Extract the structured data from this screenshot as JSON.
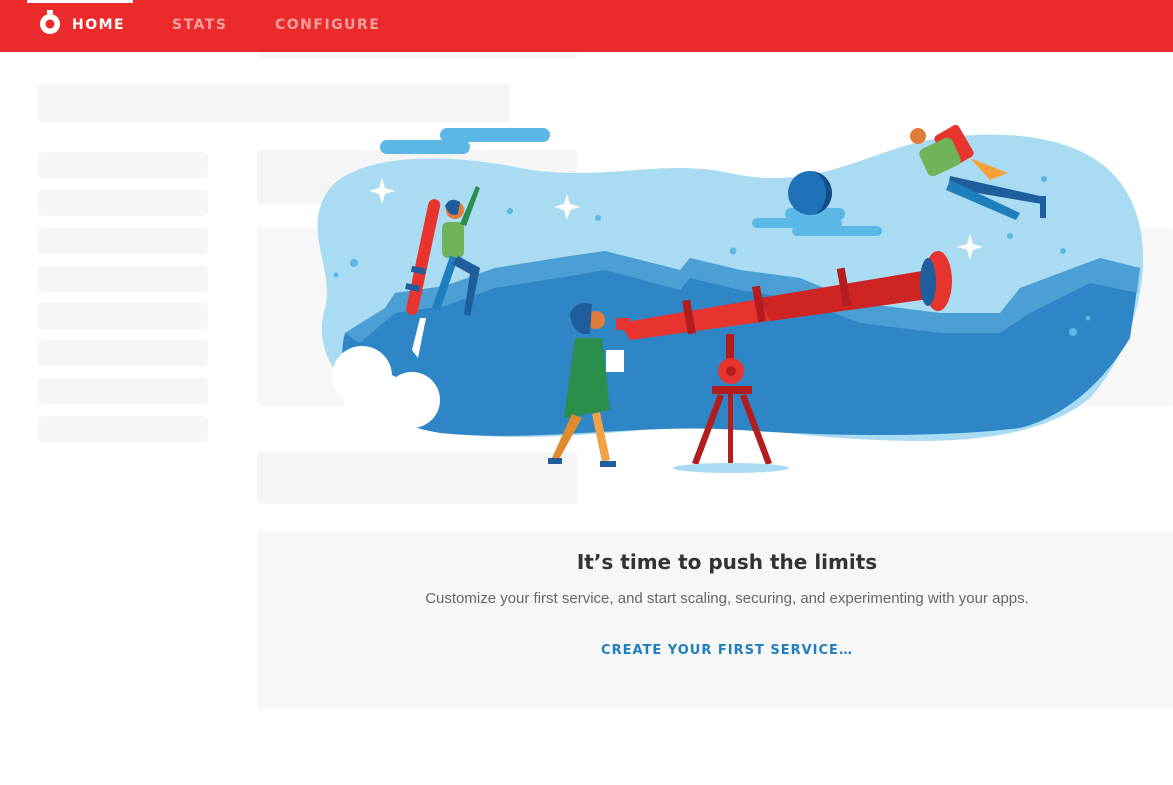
{
  "nav": {
    "items": [
      {
        "label": "HOME",
        "active": true
      },
      {
        "label": "STATS",
        "active": false
      },
      {
        "label": "CONFIGURE",
        "active": false
      }
    ],
    "logo_icon": "stopwatch-icon"
  },
  "empty_state": {
    "title": "It’s time to push the limits",
    "subtitle": "Customize your first service, and start scaling, securing, and experimenting with your apps.",
    "cta": "CREATE YOUR FIRST SERVICE…"
  },
  "colors": {
    "brand_red": "#ea2a2b",
    "link_blue": "#1f7fbd",
    "sky_blue": "#a9dcf3",
    "deep_blue": "#2f86c6",
    "skeleton_gray": "#f5f5f5"
  }
}
